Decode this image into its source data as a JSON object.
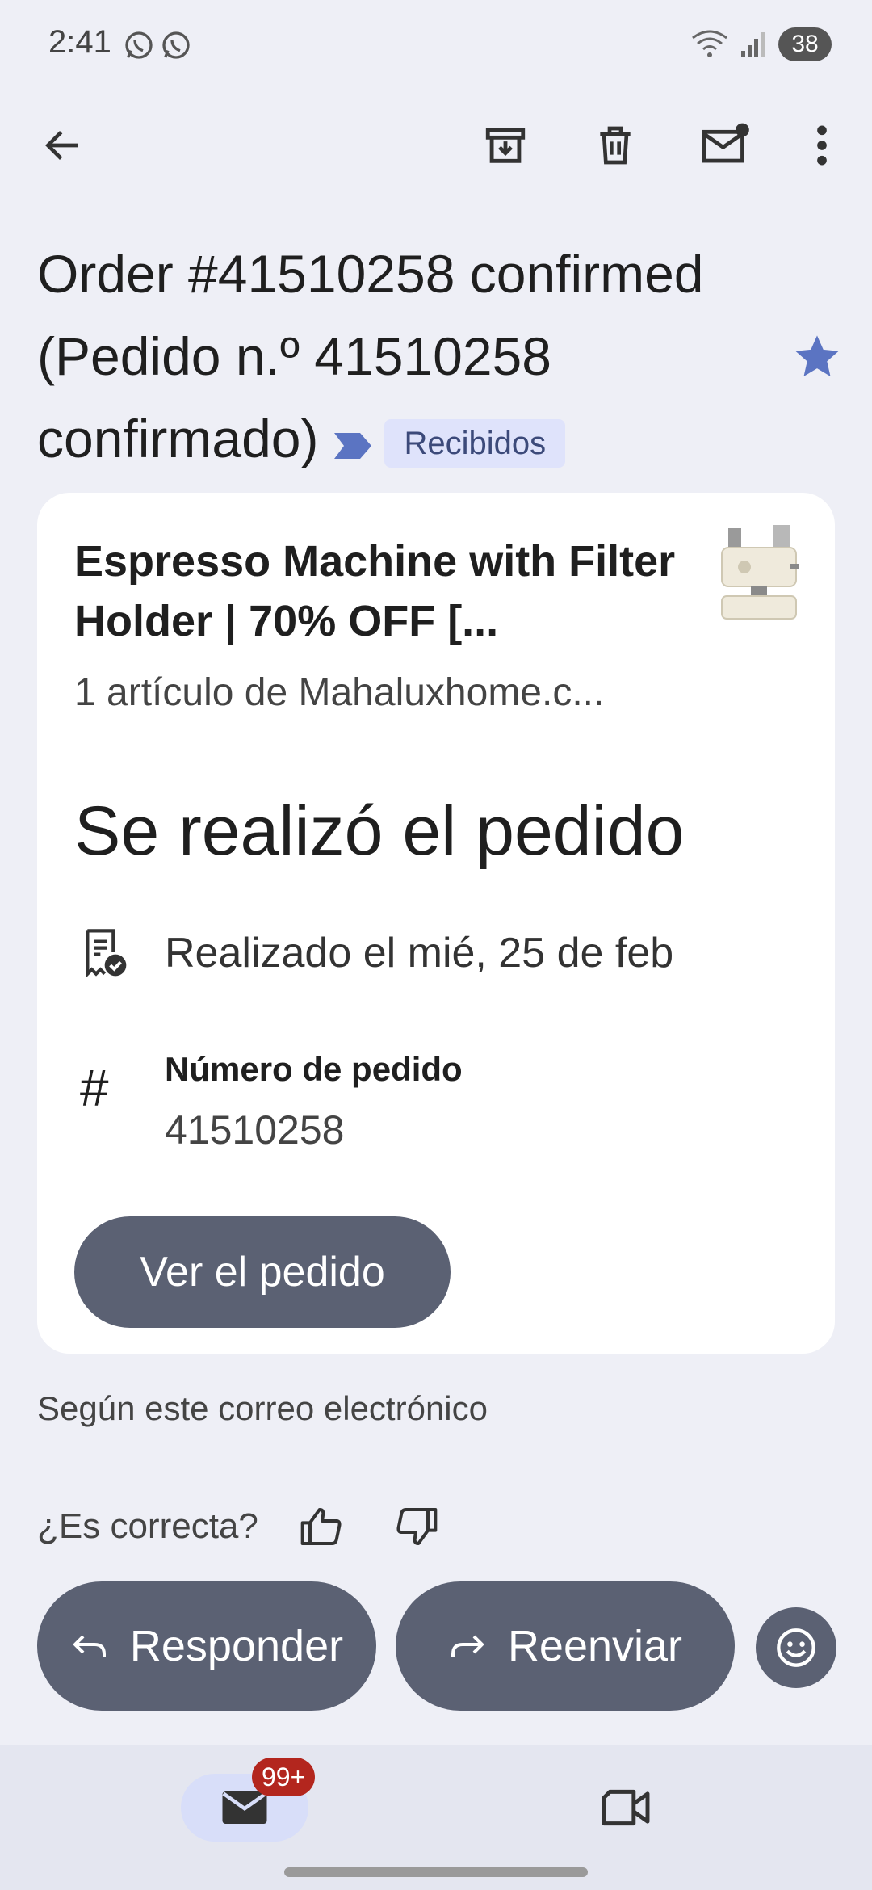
{
  "status_bar": {
    "time": "2:41",
    "battery": "38"
  },
  "toolbar": {
    "back_icon": "arrow-left-icon",
    "archive_icon": "archive-icon",
    "delete_icon": "trash-icon",
    "mark_unread_icon": "mail-unread-icon",
    "more_icon": "more-vert-icon"
  },
  "email": {
    "subject": "Order #41510258 confirmed (Pedido n.º 41510258 confirmado)",
    "label": "Recibidos"
  },
  "order_card": {
    "product_title": "Espresso Machine with Filter Holder | 70% OFF [...",
    "product_sub": "1 artículo de Mahaluxhome.c...",
    "heading": "Se realizó el pedido",
    "placed_text": "Realizado el mié, 25 de feb",
    "order_number_label": "Número de pedido",
    "order_number": "41510258",
    "view_button": "Ver el pedido"
  },
  "info_text": "Según este correo electrónico",
  "feedback": {
    "question": "¿Es correcta?"
  },
  "actions": {
    "reply": "Responder",
    "forward": "Reenviar"
  },
  "bottom_nav": {
    "mail_badge": "99+"
  },
  "colors": {
    "accent_button": "#5b6173",
    "label_bg": "#dfe3fb",
    "star": "#5b74c2",
    "badge": "#b3261e"
  }
}
